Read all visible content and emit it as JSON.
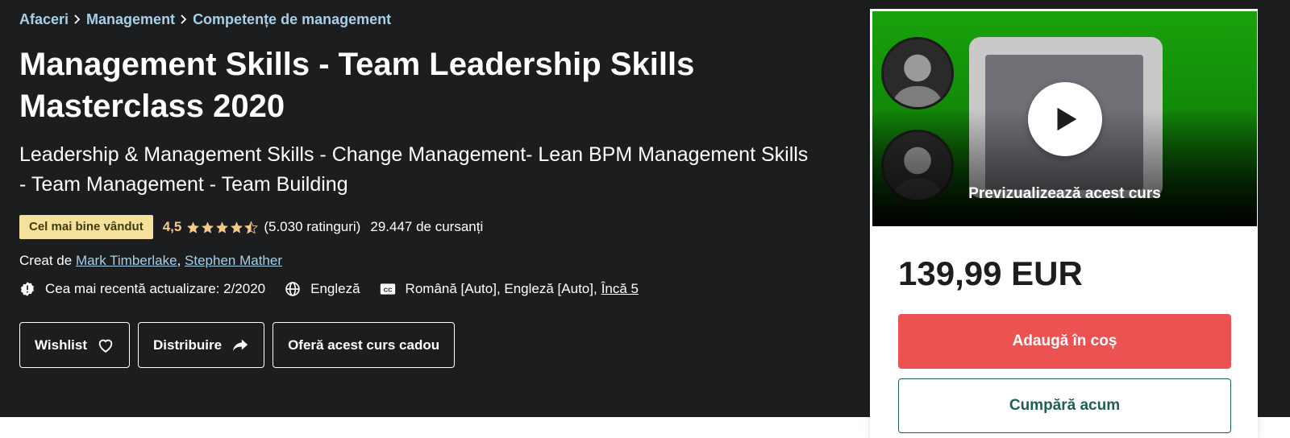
{
  "breadcrumb": [
    {
      "label": "Afaceri"
    },
    {
      "label": "Management"
    },
    {
      "label": "Competențe de management"
    }
  ],
  "course": {
    "title": "Management Skills - Team Leadership Skills Masterclass 2020",
    "subtitle": "Leadership & Management Skills - Change Management- Lean BPM Management Skills - Team Management - Team Building",
    "badge": "Cel mai bine vândut",
    "rating": "4,5",
    "rating_value": 4.5,
    "rating_count": "(5.030 ratinguri)",
    "students": "29.447 de cursanți",
    "created_by_label": "Creat de",
    "authors": [
      "Mark Timberlake",
      "Stephen Mather"
    ],
    "author_separator": ", ",
    "last_updated": "Cea mai recentă actualizare: 2/2020",
    "language": "Engleză",
    "captions": "Română [Auto], Engleză [Auto],",
    "captions_more": "Încă 5"
  },
  "actions": {
    "wishlist": "Wishlist",
    "share": "Distribuire",
    "gift": "Oferă acest curs cadou"
  },
  "sidebar": {
    "preview_label": "Previzualizează acest curs",
    "price": "139,99 EUR",
    "add_to_cart": "Adaugă în coș",
    "buy_now": "Cumpără acum"
  },
  "colors": {
    "hero_bg": "#1c1d1f",
    "link": "#a7d0e8",
    "badge_bg": "#f5e19c",
    "rating": "#f3ca8c",
    "cart_button": "#ec5252",
    "buy_button_text": "#1e6055"
  }
}
